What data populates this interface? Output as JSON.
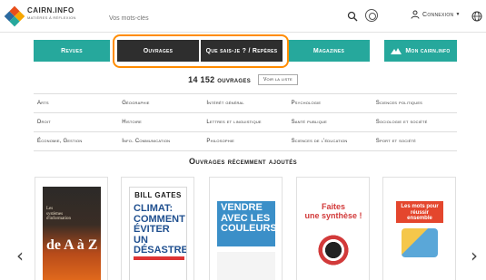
{
  "header": {
    "logo_name": "CAIRN.INFO",
    "logo_tagline": "MATIÈRES À RÉFLEXION",
    "search_placeholder": "Vos mots-clés",
    "connexion_label": "Connexion",
    "logo_colors": [
      "#e84e1b",
      "#f7a600",
      "#26a89c",
      "#2b6aa0"
    ]
  },
  "nav": {
    "items": [
      {
        "label": "Revues",
        "style": "teal"
      },
      {
        "label": "Ouvrages",
        "style": "dark"
      },
      {
        "label": "Que sais-je ? / Repères",
        "style": "dark"
      },
      {
        "label": "Magazines",
        "style": "teal"
      },
      {
        "label": "Mon cairn.info",
        "style": "teal"
      }
    ],
    "accent_color": "#26a89c",
    "dark_color": "#2e2e2e",
    "highlight_color": "#ff8c00"
  },
  "summary": {
    "count_label": "14 152 ouvrages",
    "voir_label": "Voir la liste"
  },
  "categories": [
    "Arts",
    "Géographie",
    "Intérêt général",
    "Psychologie",
    "Sciences politiques",
    "Droit",
    "Histoire",
    "Lettres et linguistique",
    "Santé publique",
    "Sociologie et société",
    "Économie, Gestion",
    "Info. Communication",
    "Philosophie",
    "Sciences de l'éducation",
    "Sport et société"
  ],
  "recent": {
    "title": "Ouvrages récemment ajoutés",
    "books": [
      {
        "cover_line1": "Les",
        "cover_line2": "systèmes",
        "cover_line3": "d'information",
        "cover_line4": "de A à Z"
      },
      {
        "author": "BILL GATES",
        "title_line1": "CLIMAT:",
        "title_line2": "COMMENT",
        "title_line3": "ÉVITER UN",
        "title_line4": "DÉSASTRE"
      },
      {
        "title_line1": "VENDRE",
        "title_line2": "AVEC LES",
        "title_line3": "COULEURS"
      },
      {
        "title_line1": "Faites",
        "title_line2": "une synthèse !"
      },
      {
        "title_line1": "Les mots pour",
        "title_line2": "réussir ensemble"
      }
    ]
  }
}
